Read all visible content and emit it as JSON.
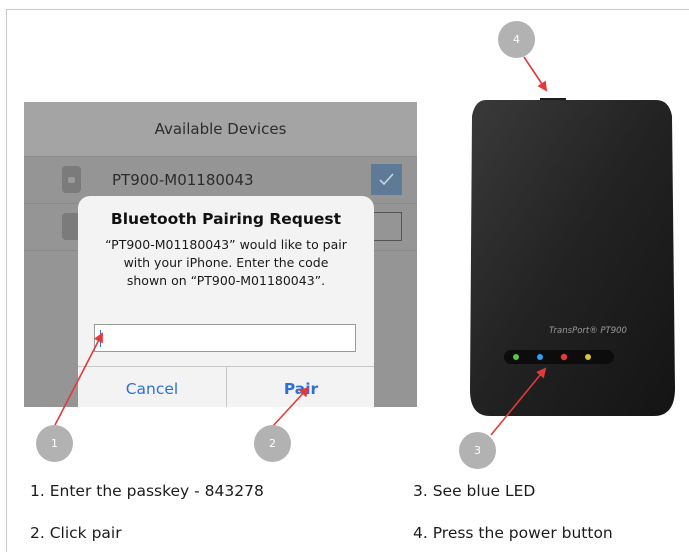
{
  "ios_dialog": {
    "header_title": "Available Devices",
    "device_name": "PT900-M01180043",
    "alert_title": "Bluetooth Pairing Request",
    "alert_message_line1": "“PT900-M01180043” would like to pair",
    "alert_message_line2": "with your iPhone. Enter the code",
    "alert_message_line3": "shown on “PT900-M01180043”.",
    "passkey_value": "",
    "cancel_label": "Cancel",
    "pair_label": "Pair"
  },
  "device": {
    "brand_label": "TransPort® PT900"
  },
  "callouts": [
    "1",
    "2",
    "3",
    "4"
  ],
  "captions": {
    "step1": "1. Enter the passkey - 843278",
    "step2": "2. Click pair",
    "step3": "3. See blue LED",
    "step4": "4. Press the power button"
  },
  "colors": {
    "arrow": "#e23a3a",
    "callout": "#b2b2b2",
    "ios_button": "#2f6fd6",
    "checkmark_bg": "#5e7a97",
    "led_blue": "#2aa0ff"
  }
}
